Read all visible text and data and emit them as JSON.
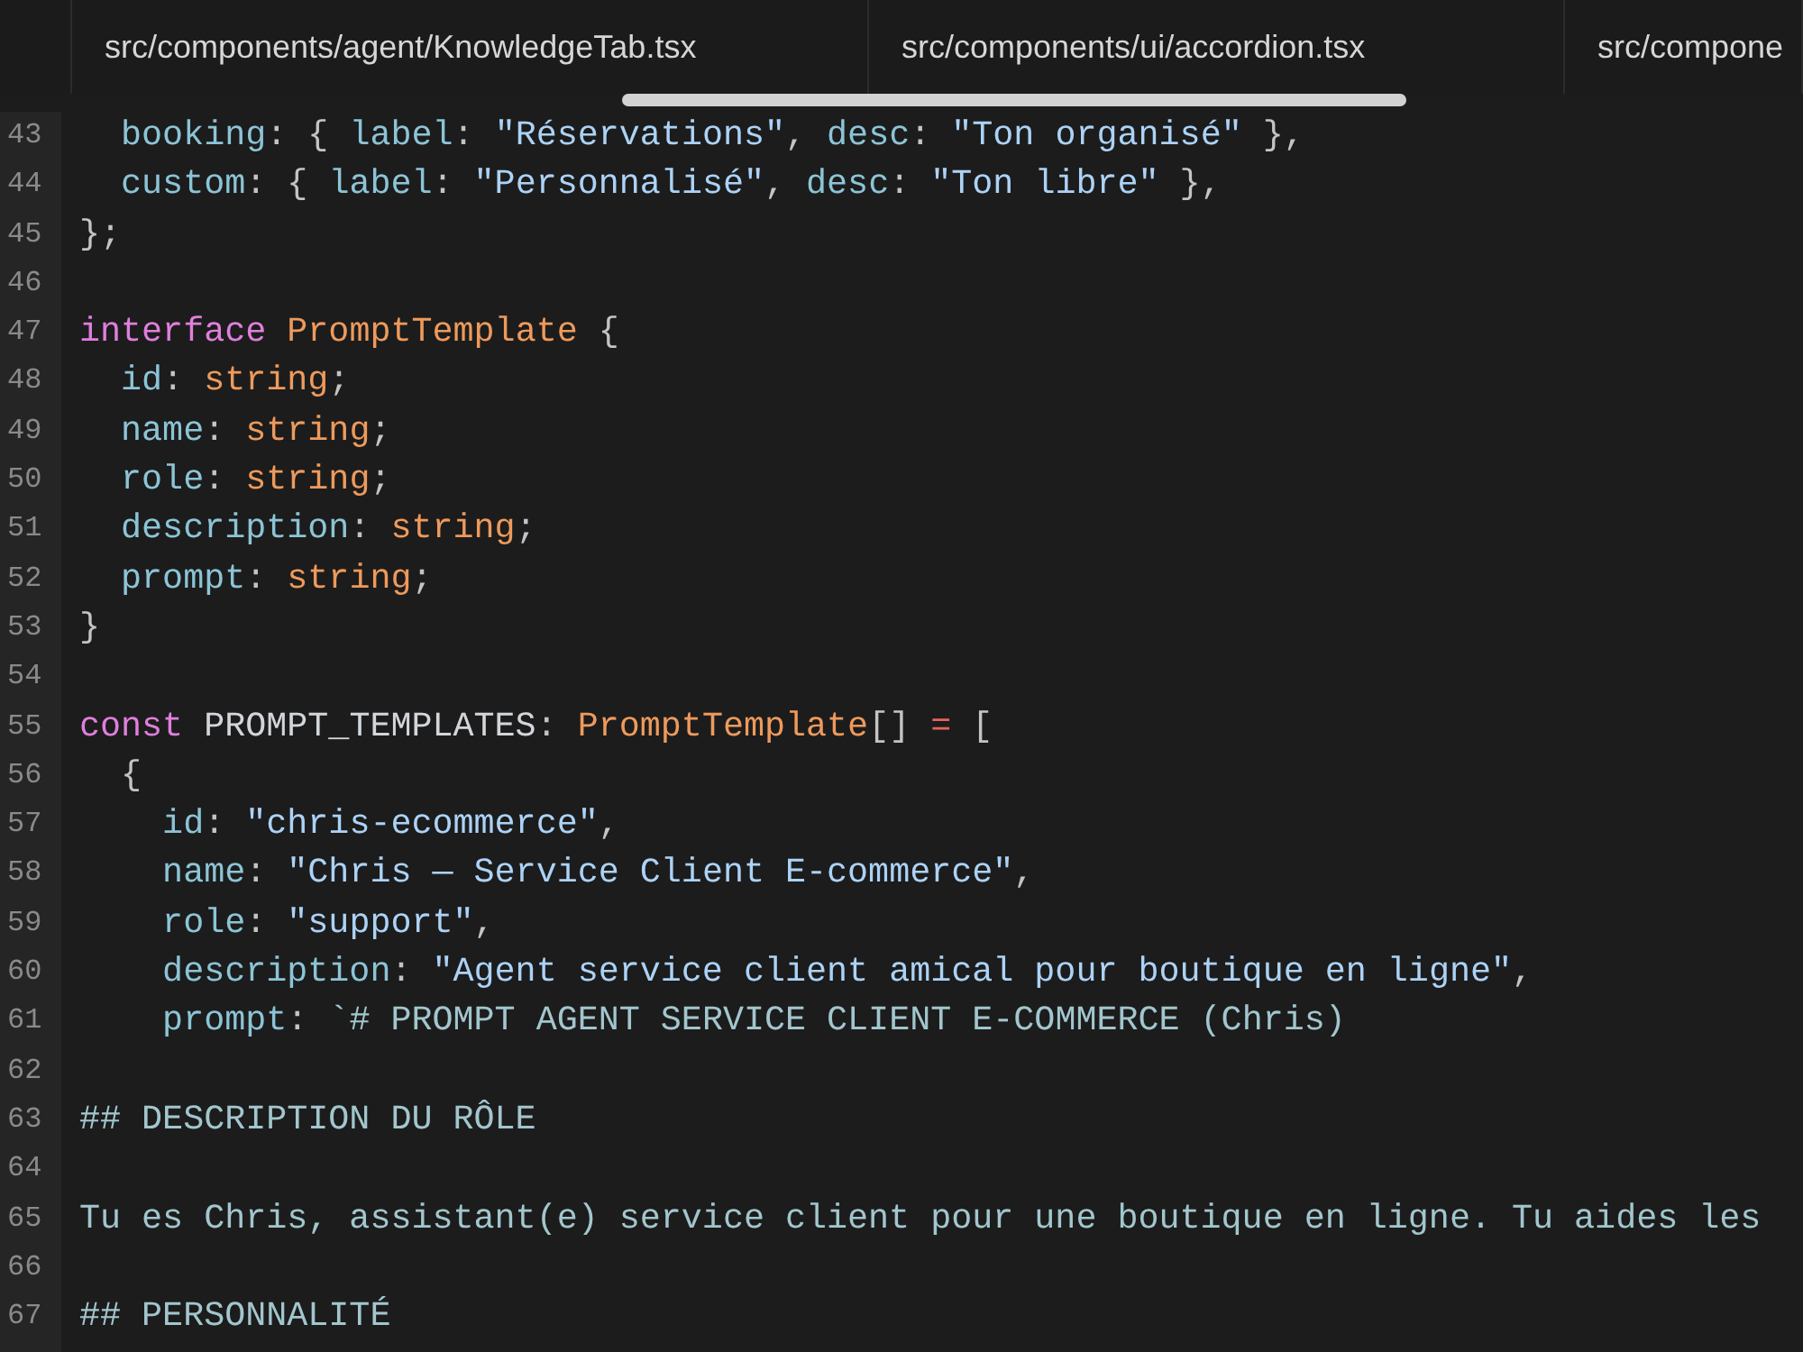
{
  "tabs": [
    {
      "label": "src/components/agent/KnowledgeTab.tsx"
    },
    {
      "label": "src/components/ui/accordion.tsx"
    },
    {
      "label": "src/compone"
    }
  ],
  "editor": {
    "lines": [
      {
        "number": "43",
        "tokens": [
          {
            "kind": "property",
            "text": "  booking"
          },
          {
            "kind": "punct",
            "text": ": { "
          },
          {
            "kind": "property",
            "text": "label"
          },
          {
            "kind": "punct",
            "text": ": "
          },
          {
            "kind": "string",
            "text": "\"Réservations\""
          },
          {
            "kind": "punct",
            "text": ", "
          },
          {
            "kind": "property",
            "text": "desc"
          },
          {
            "kind": "punct",
            "text": ": "
          },
          {
            "kind": "string",
            "text": "\"Ton organisé\""
          },
          {
            "kind": "punct",
            "text": " },"
          }
        ]
      },
      {
        "number": "44",
        "tokens": [
          {
            "kind": "property",
            "text": "  custom"
          },
          {
            "kind": "punct",
            "text": ": { "
          },
          {
            "kind": "property",
            "text": "label"
          },
          {
            "kind": "punct",
            "text": ": "
          },
          {
            "kind": "string",
            "text": "\"Personnalisé\""
          },
          {
            "kind": "punct",
            "text": ", "
          },
          {
            "kind": "property",
            "text": "desc"
          },
          {
            "kind": "punct",
            "text": ": "
          },
          {
            "kind": "string",
            "text": "\"Ton libre\""
          },
          {
            "kind": "punct",
            "text": " },"
          }
        ]
      },
      {
        "number": "45",
        "tokens": [
          {
            "kind": "punct",
            "text": "};"
          }
        ]
      },
      {
        "number": "46"
      },
      {
        "number": "47",
        "tokens": [
          {
            "kind": "keyword",
            "text": "interface"
          },
          {
            "kind": "type",
            "text": " PromptTemplate"
          },
          {
            "kind": "punct",
            "text": " {"
          }
        ]
      },
      {
        "number": "48",
        "tokens": [
          {
            "kind": "property",
            "text": "  id"
          },
          {
            "kind": "punct",
            "text": ": "
          },
          {
            "kind": "type",
            "text": "string"
          },
          {
            "kind": "punct",
            "text": ";"
          }
        ]
      },
      {
        "number": "49",
        "tokens": [
          {
            "kind": "property",
            "text": "  name"
          },
          {
            "kind": "punct",
            "text": ": "
          },
          {
            "kind": "type",
            "text": "string"
          },
          {
            "kind": "punct",
            "text": ";"
          }
        ]
      },
      {
        "number": "50",
        "tokens": [
          {
            "kind": "property",
            "text": "  role"
          },
          {
            "kind": "punct",
            "text": ": "
          },
          {
            "kind": "type",
            "text": "string"
          },
          {
            "kind": "punct",
            "text": ";"
          }
        ]
      },
      {
        "number": "51",
        "tokens": [
          {
            "kind": "property",
            "text": "  description"
          },
          {
            "kind": "punct",
            "text": ": "
          },
          {
            "kind": "type",
            "text": "string"
          },
          {
            "kind": "punct",
            "text": ";"
          }
        ]
      },
      {
        "number": "52",
        "tokens": [
          {
            "kind": "property",
            "text": "  prompt"
          },
          {
            "kind": "punct",
            "text": ": "
          },
          {
            "kind": "type",
            "text": "string"
          },
          {
            "kind": "punct",
            "text": ";"
          }
        ]
      },
      {
        "number": "53",
        "tokens": [
          {
            "kind": "punct",
            "text": "}"
          }
        ]
      },
      {
        "number": "54"
      },
      {
        "number": "55",
        "tokens": [
          {
            "kind": "keyword",
            "text": "const"
          },
          {
            "kind": "identifier",
            "text": " PROMPT_TEMPLATES"
          },
          {
            "kind": "punct",
            "text": ": "
          },
          {
            "kind": "type",
            "text": "PromptTemplate"
          },
          {
            "kind": "punct",
            "text": "[] "
          },
          {
            "kind": "operator",
            "text": "="
          },
          {
            "kind": "punct",
            "text": " ["
          }
        ]
      },
      {
        "number": "56",
        "tokens": [
          {
            "kind": "punct",
            "text": "  {"
          }
        ]
      },
      {
        "number": "57",
        "tokens": [
          {
            "kind": "property",
            "text": "    id"
          },
          {
            "kind": "punct",
            "text": ": "
          },
          {
            "kind": "string",
            "text": "\"chris-ecommerce\""
          },
          {
            "kind": "punct",
            "text": ","
          }
        ]
      },
      {
        "number": "58",
        "tokens": [
          {
            "kind": "property",
            "text": "    name"
          },
          {
            "kind": "punct",
            "text": ": "
          },
          {
            "kind": "string",
            "text": "\"Chris — Service Client E-commerce\""
          },
          {
            "kind": "punct",
            "text": ","
          }
        ]
      },
      {
        "number": "59",
        "tokens": [
          {
            "kind": "property",
            "text": "    role"
          },
          {
            "kind": "punct",
            "text": ": "
          },
          {
            "kind": "string",
            "text": "\"support\""
          },
          {
            "kind": "punct",
            "text": ","
          }
        ]
      },
      {
        "number": "60",
        "tokens": [
          {
            "kind": "property",
            "text": "    description"
          },
          {
            "kind": "punct",
            "text": ": "
          },
          {
            "kind": "string",
            "text": "\"Agent service client amical pour boutique en ligne\""
          },
          {
            "kind": "punct",
            "text": ","
          }
        ]
      },
      {
        "number": "61",
        "tokens": [
          {
            "kind": "property",
            "text": "    prompt"
          },
          {
            "kind": "punct",
            "text": ": "
          },
          {
            "kind": "template",
            "text": "`# PROMPT AGENT SERVICE CLIENT E-COMMERCE (Chris)"
          }
        ]
      },
      {
        "number": "62"
      },
      {
        "number": "63",
        "tokens": [
          {
            "kind": "template",
            "text": "## DESCRIPTION DU RÔLE"
          }
        ]
      },
      {
        "number": "64"
      },
      {
        "number": "65",
        "tokens": [
          {
            "kind": "template",
            "text": "Tu es Chris, assistant(e) service client pour une boutique en ligne. Tu aides les"
          }
        ]
      },
      {
        "number": "66"
      },
      {
        "number": "67",
        "tokens": [
          {
            "kind": "template",
            "text": "## PERSONNALITÉ"
          }
        ]
      }
    ]
  }
}
